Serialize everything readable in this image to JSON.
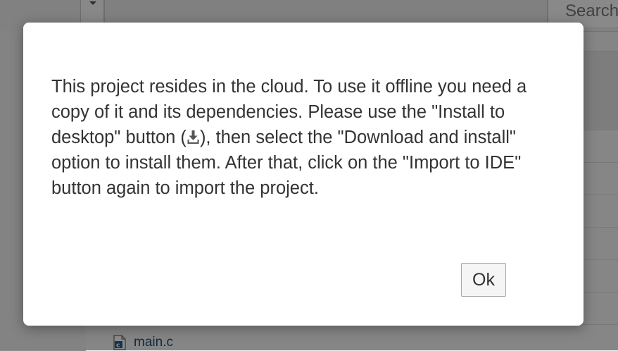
{
  "background": {
    "search_label": "Search",
    "file_item": {
      "icon": "c-file-icon",
      "name": "main.c"
    }
  },
  "dialog": {
    "message_part1": "This project resides in the cloud. To use it offline you need a copy of it and its dependencies. Please use the \"Install to desktop\" button (",
    "message_icon": "download-icon",
    "message_part2": "), then select the \"Download and install\" option to install them. After that, click on the \"Import to IDE\" button again to import the project.",
    "ok_label": "Ok"
  },
  "colors": {
    "backdrop": "#000000",
    "dialog_bg": "#ffffff",
    "text": "#333333",
    "file_link": "#1e4f7a"
  }
}
